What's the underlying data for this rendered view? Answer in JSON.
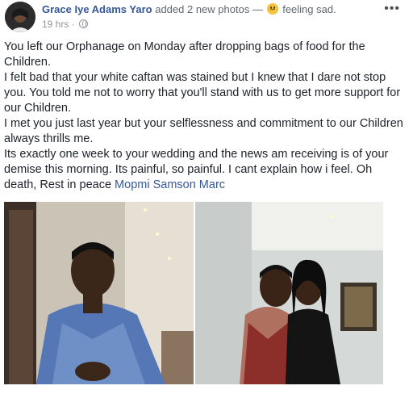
{
  "post": {
    "author": "Grace Iye Adams Yaro",
    "action": "added 2 new photos",
    "separator": "—",
    "feeling": "feeling sad.",
    "time": "19 hrs",
    "dot": "·",
    "more_glyph": "•••",
    "text_lines": [
      "You left our Orphanage on Monday after dropping bags of food for the Children.",
      "I felt bad that your white caftan was stained but I knew that I dare not stop you. You told me not to worry that you'll stand with us to get more support for our Children.",
      "I met you just last year but your selflessness and commitment to our Children always thrills me.",
      "Its exactly one week to your wedding and the news am receiving is of your demise this morning. Its painful, so painful. I cant explain how i feel. Oh death, Rest in peace"
    ],
    "mention": "Mopmi Samson Marc"
  },
  "icons": {
    "feeling": "sad-face-icon",
    "privacy": "globe-icon",
    "options": "more-options-icon"
  },
  "colors": {
    "link": "#365899",
    "text": "#1d2129",
    "muted": "#90949c",
    "emoji": "#f5c33b"
  }
}
